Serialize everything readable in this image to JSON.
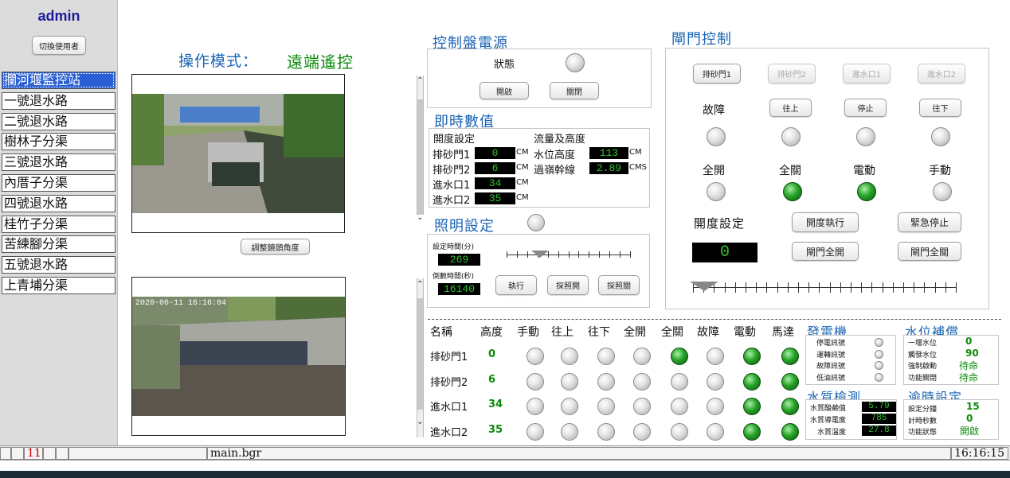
{
  "user": {
    "name": "admin",
    "switch_label": "切換使用者"
  },
  "sites": [
    "攔河堰監控站",
    "一號退水路",
    "二號退水路",
    "樹林子分渠",
    "三號退水路",
    "內厝子分渠",
    "四號退水路",
    "桂竹子分渠",
    "苦練腳分渠",
    "五號退水路",
    "上青埔分渠"
  ],
  "mode": {
    "label": "操作模式：",
    "value": "遠端遙控"
  },
  "camera": {
    "adjust_label": "調整鏡頭角度",
    "timestamp": "2020-06-11 16:16:04"
  },
  "power": {
    "title": "控制盤電源",
    "status_label": "狀態",
    "open_label": "開啟",
    "close_label": "關閉"
  },
  "realtime": {
    "title": "即時數值",
    "opening_header": "開度設定",
    "flow_header": "流量及高度",
    "rows": [
      {
        "name": "排砂門1",
        "value": "0",
        "unit": "CM"
      },
      {
        "name": "排砂門2",
        "value": "6",
        "unit": "CM"
      },
      {
        "name": "進水口1",
        "value": "34",
        "unit": "CM"
      },
      {
        "name": "進水口2",
        "value": "35",
        "unit": "CM"
      }
    ],
    "flow": [
      {
        "name": "水位高度",
        "value": "113",
        "unit": "CM"
      },
      {
        "name": "過嶺幹線",
        "value": "2.89",
        "unit": "CMS"
      }
    ]
  },
  "lighting": {
    "title": "照明設定",
    "set_time_label": "設定時間(分)",
    "set_time_value": "269",
    "countdown_label": "倒數時間(秒)",
    "countdown_value": "16140",
    "exec_label": "執行",
    "on_label": "探照開",
    "off_label": "探照關",
    "slider_fraction": 0.27
  },
  "gate": {
    "title": "閘門控制",
    "tabs": [
      "排砂門1",
      "排砂門2",
      "進水口1",
      "進水口2"
    ],
    "fault_label": "故障",
    "up_label": "往上",
    "stop_label": "停止",
    "down_label": "往下",
    "indicators": [
      "全開",
      "全關",
      "電動",
      "手動"
    ],
    "indicator_on": [
      false,
      true,
      true,
      false
    ],
    "opening_label": "開度設定",
    "opening_value": "0",
    "exec_label": "開度執行",
    "estop_label": "緊急停止",
    "open_all_label": "閘門全開",
    "close_all_label": "閘門全關",
    "slider_fraction": 0.0
  },
  "table": {
    "headers": [
      "名稱",
      "高度",
      "手動",
      "往上",
      "往下",
      "全開",
      "全關",
      "故障",
      "電動",
      "馬達"
    ],
    "rows": [
      {
        "name": "排砂門1",
        "height": "0",
        "states": [
          false,
          false,
          false,
          false,
          true,
          false,
          true,
          true
        ]
      },
      {
        "name": "排砂門2",
        "height": "6",
        "states": [
          false,
          false,
          false,
          false,
          false,
          false,
          true,
          true
        ]
      },
      {
        "name": "進水口1",
        "height": "34",
        "states": [
          false,
          false,
          false,
          false,
          false,
          false,
          true,
          true
        ]
      },
      {
        "name": "進水口2",
        "height": "35",
        "states": [
          false,
          false,
          false,
          false,
          false,
          false,
          true,
          true
        ]
      }
    ]
  },
  "generator": {
    "title": "發電機",
    "items": [
      "停電訊號",
      "運轉訊號",
      "故障訊號",
      "低油訊號"
    ]
  },
  "water_level": {
    "title": "水位補償",
    "items": [
      {
        "label": "一堰水位",
        "value": "0"
      },
      {
        "label": "觸發水位",
        "value": "90"
      },
      {
        "label": "強制啟動",
        "value": "待命"
      },
      {
        "label": "功能關閉",
        "value": "待命"
      }
    ]
  },
  "quality": {
    "title": "水質檢測",
    "items": [
      {
        "label": "水質酸鹼值",
        "value": "5.79"
      },
      {
        "label": "水質導電度",
        "value": "785"
      },
      {
        "label": "水質溫度",
        "value": "27.8"
      }
    ]
  },
  "timer": {
    "title": "逾時設定",
    "items": [
      {
        "label": "設定分鐘",
        "value": "15"
      },
      {
        "label": "計時秒數",
        "value": "0"
      },
      {
        "label": "功能狀態",
        "value": "開啟"
      }
    ]
  },
  "statusbar": {
    "counter": "11",
    "file": "main.bgr",
    "time": "16:16:15"
  },
  "colors": {
    "accent_blue": "#1a63b3",
    "green_text": "#0b8a0b",
    "display_bg": "#000000",
    "display_fg": "#2fc42f",
    "selected_site": "#2b5fd6"
  }
}
